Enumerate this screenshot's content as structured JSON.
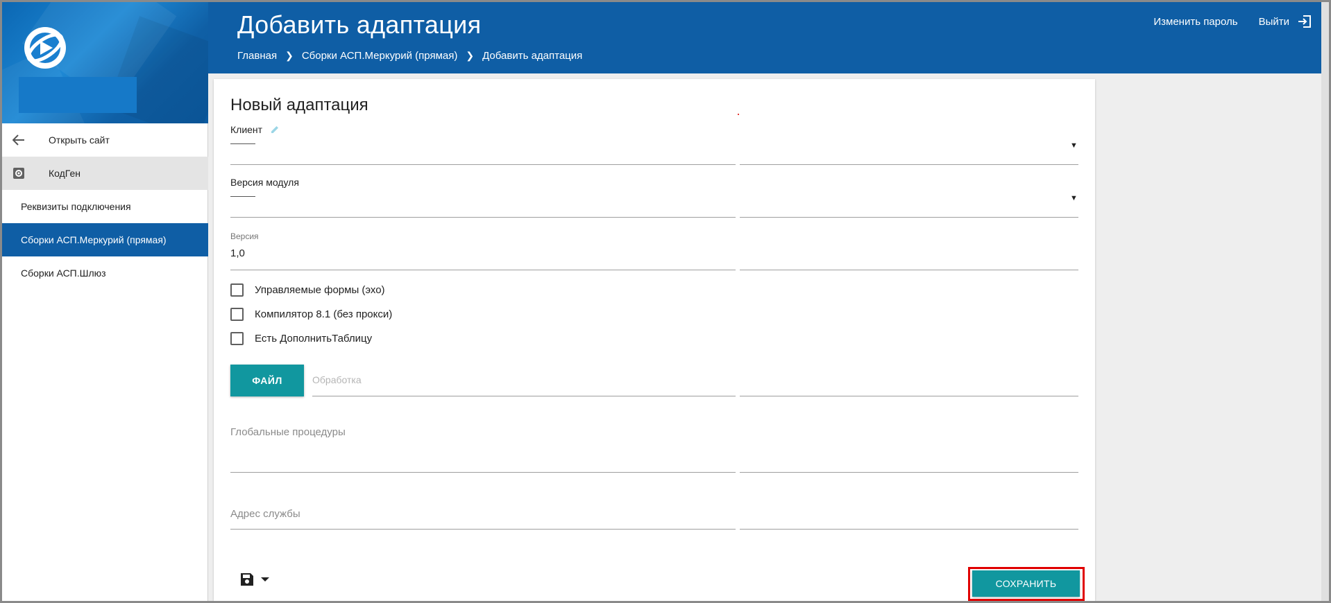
{
  "header": {
    "title": "Добавить адаптация",
    "breadcrumb": [
      "Главная",
      "Сборки АСП.Меркурий (прямая)",
      "Добавить адаптация"
    ],
    "change_password": "Изменить пароль",
    "logout": "Выйти"
  },
  "sidebar": {
    "open_site": "Открыть сайт",
    "section": "КодГен",
    "items": [
      {
        "label": "Реквизиты подключения"
      },
      {
        "label": "Сборки АСП.Меркурий (прямая)"
      },
      {
        "label": "Сборки АСП.Шлюз"
      }
    ]
  },
  "form": {
    "title": "Новый адаптация",
    "client_label": "Клиент",
    "module_version_label": "Версия модуля",
    "version_label": "Версия",
    "version_value": "1,0",
    "checkboxes": [
      {
        "label": "Управляемые формы (эхо)",
        "checked": false
      },
      {
        "label": "Компилятор 8.1 (без прокси)",
        "checked": false
      },
      {
        "label": "Есть ДополнитьТаблицу",
        "checked": false
      }
    ],
    "file_button": "ФАЙЛ",
    "file_placeholder": "Обработка",
    "global_procedures_label": "Глобальные процедуры",
    "service_address_label": "Адрес службы",
    "save_button": "СОХРАНИТЬ"
  },
  "colors": {
    "primary": "#0f5ea5",
    "accent": "#11979f",
    "highlight": "#e00000"
  }
}
